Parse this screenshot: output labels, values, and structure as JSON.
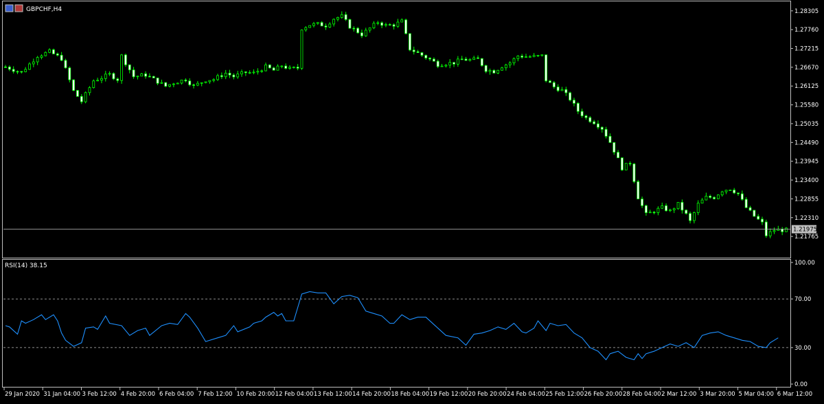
{
  "window": {
    "symbol_title": "GBPCHF,H4",
    "indicator_title": "RSI(14) 38.15",
    "icon_names": [
      "chart-window-icon",
      "chart-mode-icon"
    ]
  },
  "colors": {
    "background": "#000000",
    "frame": "#c0c0c0",
    "bull_candle": "#ffffff",
    "candle_outline": "#00ff00",
    "rsi_line": "#1e90ff",
    "level_line": "#c0c0c0",
    "current_price_tag": "#c0c0c0"
  },
  "chart_data": [
    {
      "type": "candlestick",
      "title": "GBPCHF,H4",
      "y_ticks": [
        "1.28305",
        "1.27760",
        "1.27215",
        "1.26670",
        "1.26125",
        "1.25580",
        "1.25035",
        "1.24490",
        "1.23945",
        "1.23400",
        "1.22855",
        "1.22310",
        "1.21765"
      ],
      "ylim": [
        1.2121,
        1.285
      ],
      "current_price": 1.21975,
      "current_price_label": "1.21975",
      "x_ticks": [
        "29 Jan 2020",
        "31 Jan 04:00",
        "3 Feb 12:00",
        "4 Feb 20:00",
        "6 Feb 04:00",
        "7 Feb 12:00",
        "10 Feb 20:00",
        "12 Feb 04:00",
        "13 Feb 12:00",
        "14 Feb 20:00",
        "18 Feb 04:00",
        "19 Feb 12:00",
        "20 Feb 20:00",
        "24 Feb 04:00",
        "25 Feb 12:00",
        "26 Feb 20:00",
        "28 Feb 04:00",
        "2 Mar 12:00",
        "3 Mar 20:00",
        "5 Mar 04:00",
        "6 Mar 12:00"
      ],
      "close_points": [
        [
          0,
          1.2668
        ],
        [
          4,
          1.2652
        ],
        [
          8,
          1.27
        ],
        [
          11,
          1.2712
        ],
        [
          14,
          1.2692
        ],
        [
          17,
          1.2598
        ],
        [
          19,
          1.2568
        ],
        [
          22,
          1.2628
        ],
        [
          26,
          1.2646
        ],
        [
          28,
          1.2632
        ],
        [
          29,
          1.27
        ],
        [
          32,
          1.264
        ],
        [
          35,
          1.2645
        ],
        [
          37,
          1.2632
        ],
        [
          40,
          1.2612
        ],
        [
          42,
          1.2622
        ],
        [
          45,
          1.2632
        ],
        [
          47,
          1.2612
        ],
        [
          50,
          1.263
        ],
        [
          52,
          1.2632
        ],
        [
          55,
          1.265
        ],
        [
          57,
          1.264
        ],
        [
          60,
          1.2652
        ],
        [
          62,
          1.265
        ],
        [
          65,
          1.2668
        ],
        [
          67,
          1.2658
        ],
        [
          69,
          1.2672
        ],
        [
          71,
          1.2662
        ],
        [
          73,
          1.2665
        ],
        [
          74,
          1.278
        ],
        [
          76,
          1.279
        ],
        [
          78,
          1.2792
        ],
        [
          80,
          1.2788
        ],
        [
          82,
          1.2808
        ],
        [
          84,
          1.2815
        ],
        [
          86,
          1.2785
        ],
        [
          89,
          1.2762
        ],
        [
          91,
          1.278
        ],
        [
          93,
          1.2798
        ],
        [
          95,
          1.2788
        ],
        [
          97,
          1.279
        ],
        [
          99,
          1.28
        ],
        [
          101,
          1.272
        ],
        [
          103,
          1.2708
        ],
        [
          106,
          1.269
        ],
        [
          108,
          1.2675
        ],
        [
          110,
          1.2678
        ],
        [
          112,
          1.268
        ],
        [
          114,
          1.269
        ],
        [
          116,
          1.2688
        ],
        [
          118,
          1.269
        ],
        [
          120,
          1.266
        ],
        [
          122,
          1.2655
        ],
        [
          124,
          1.267
        ],
        [
          126,
          1.268
        ],
        [
          128,
          1.27
        ],
        [
          130,
          1.2698
        ],
        [
          132,
          1.2698
        ],
        [
          134,
          1.27
        ],
        [
          135,
          1.263
        ],
        [
          137,
          1.261
        ],
        [
          139,
          1.26
        ],
        [
          141,
          1.2575
        ],
        [
          143,
          1.254
        ],
        [
          145,
          1.252
        ],
        [
          147,
          1.2508
        ],
        [
          149,
          1.249
        ],
        [
          151,
          1.245
        ],
        [
          153,
          1.24
        ],
        [
          154,
          1.2375
        ],
        [
          156,
          1.239
        ],
        [
          158,
          1.229
        ],
        [
          160,
          1.224
        ],
        [
          162,
          1.225
        ],
        [
          164,
          1.226
        ],
        [
          166,
          1.225
        ],
        [
          168,
          1.227
        ],
        [
          170,
          1.224
        ],
        [
          171,
          1.222
        ],
        [
          173,
          1.227
        ],
        [
          175,
          1.229
        ],
        [
          177,
          1.229
        ],
        [
          179,
          1.231
        ],
        [
          181,
          1.2315
        ],
        [
          183,
          1.23
        ],
        [
          185,
          1.226
        ],
        [
          187,
          1.2235
        ],
        [
          189,
          1.2215
        ],
        [
          190,
          1.218
        ],
        [
          192,
          1.2195
        ]
      ]
    },
    {
      "type": "line",
      "title": "RSI(14) 38.15",
      "y_ticks": [
        "100.00",
        "70.00",
        "30.00",
        "0.00"
      ],
      "ylim": [
        0,
        100
      ],
      "levels": [
        70,
        30
      ],
      "x_ticks": [
        "29 Jan 2020",
        "31 Jan 04:00",
        "3 Feb 12:00",
        "4 Feb 20:00",
        "6 Feb 04:00",
        "7 Feb 12:00",
        "10 Feb 20:00",
        "12 Feb 04:00",
        "13 Feb 12:00",
        "14 Feb 20:00",
        "18 Feb 04:00",
        "19 Feb 12:00",
        "20 Feb 20:00",
        "24 Feb 04:00",
        "25 Feb 12:00",
        "26 Feb 20:00",
        "28 Feb 04:00",
        "2 Mar 12:00",
        "3 Mar 20:00",
        "5 Mar 04:00",
        "6 Mar 12:00"
      ],
      "points": [
        [
          0,
          48
        ],
        [
          1,
          47
        ],
        [
          3,
          41
        ],
        [
          4,
          52
        ],
        [
          5,
          50
        ],
        [
          7,
          53
        ],
        [
          9,
          57
        ],
        [
          10,
          53
        ],
        [
          12,
          57
        ],
        [
          13,
          52
        ],
        [
          14,
          42
        ],
        [
          15,
          36
        ],
        [
          17,
          31
        ],
        [
          19,
          34
        ],
        [
          20,
          46
        ],
        [
          22,
          47
        ],
        [
          23,
          45
        ],
        [
          25,
          56
        ],
        [
          26,
          50
        ],
        [
          29,
          48
        ],
        [
          31,
          40
        ],
        [
          33,
          44
        ],
        [
          35,
          46
        ],
        [
          36,
          40
        ],
        [
          39,
          48
        ],
        [
          41,
          50
        ],
        [
          43,
          49
        ],
        [
          45,
          58
        ],
        [
          46,
          55
        ],
        [
          48,
          46
        ],
        [
          50,
          35
        ],
        [
          53,
          38
        ],
        [
          55,
          40
        ],
        [
          57,
          48
        ],
        [
          58,
          43
        ],
        [
          61,
          47
        ],
        [
          62,
          50
        ],
        [
          64,
          52
        ],
        [
          65,
          55
        ],
        [
          67,
          59
        ],
        [
          68,
          56
        ],
        [
          69,
          58
        ],
        [
          70,
          52
        ],
        [
          72,
          52
        ],
        [
          74,
          74
        ],
        [
          76,
          76
        ],
        [
          78,
          75
        ],
        [
          80,
          75
        ],
        [
          82,
          66
        ],
        [
          84,
          72
        ],
        [
          86,
          73
        ],
        [
          88,
          71
        ],
        [
          90,
          60
        ],
        [
          92,
          58
        ],
        [
          94,
          56
        ],
        [
          96,
          50
        ],
        [
          97,
          50
        ],
        [
          99,
          57
        ],
        [
          101,
          53
        ],
        [
          103,
          55
        ],
        [
          105,
          55
        ],
        [
          107,
          49
        ],
        [
          110,
          40
        ],
        [
          113,
          38
        ],
        [
          115,
          32
        ],
        [
          117,
          41
        ],
        [
          119,
          42
        ],
        [
          121,
          44
        ],
        [
          123,
          47
        ],
        [
          125,
          45
        ],
        [
          127,
          50
        ],
        [
          129,
          43
        ],
        [
          130,
          42
        ],
        [
          132,
          46
        ],
        [
          133,
          52
        ],
        [
          135,
          44
        ],
        [
          136,
          50
        ],
        [
          138,
          48
        ],
        [
          140,
          49
        ],
        [
          142,
          42
        ],
        [
          144,
          38
        ],
        [
          146,
          30
        ],
        [
          148,
          27
        ],
        [
          150,
          20
        ],
        [
          151,
          25
        ],
        [
          153,
          27
        ],
        [
          155,
          22
        ],
        [
          157,
          20
        ],
        [
          158,
          25
        ],
        [
          159,
          21
        ],
        [
          160,
          25
        ],
        [
          162,
          27
        ],
        [
          164,
          30
        ],
        [
          166,
          33
        ],
        [
          168,
          31
        ],
        [
          170,
          34
        ],
        [
          172,
          30
        ],
        [
          174,
          40
        ],
        [
          176,
          42
        ],
        [
          178,
          43
        ],
        [
          180,
          40
        ],
        [
          182,
          38
        ],
        [
          184,
          36
        ],
        [
          186,
          35
        ],
        [
          188,
          31
        ],
        [
          190,
          30
        ],
        [
          191,
          34
        ],
        [
          193,
          38
        ]
      ]
    }
  ]
}
